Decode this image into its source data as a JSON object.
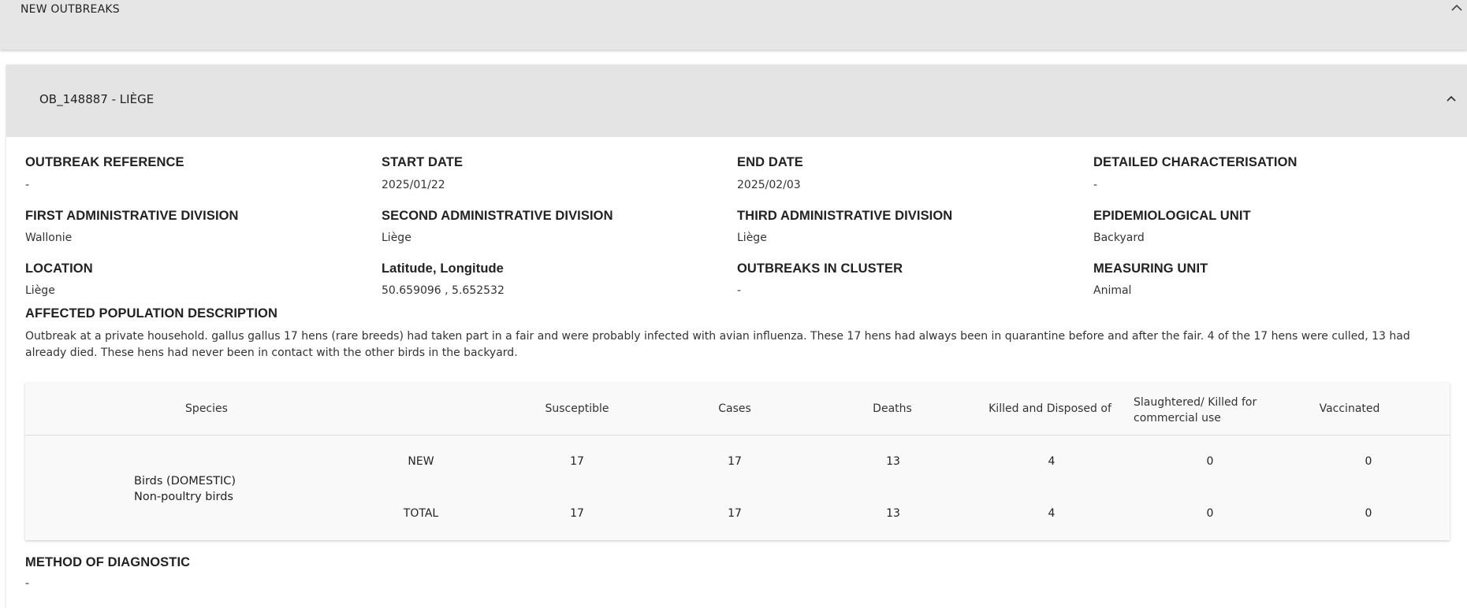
{
  "top_panel": {
    "title": "NEW OUTBREAKS"
  },
  "outbreak": {
    "title": "OB_148887 - LIÈGE",
    "fields": [
      {
        "label": "OUTBREAK REFERENCE",
        "value": "-"
      },
      {
        "label": "START DATE",
        "value": "2025/01/22"
      },
      {
        "label": "END DATE",
        "value": "2025/02/03"
      },
      {
        "label": "DETAILED CHARACTERISATION",
        "value": "-"
      },
      {
        "label": "FIRST ADMINISTRATIVE DIVISION",
        "value": "Wallonie"
      },
      {
        "label": "SECOND ADMINISTRATIVE DIVISION",
        "value": "Liège"
      },
      {
        "label": "THIRD ADMINISTRATIVE DIVISION",
        "value": "Liège"
      },
      {
        "label": "EPIDEMIOLOGICAL UNIT",
        "value": "Backyard"
      },
      {
        "label": "LOCATION",
        "value": "Liège"
      },
      {
        "label": "Latitude, Longitude",
        "value": "50.659096 , 5.652532"
      },
      {
        "label": "OUTBREAKS IN CLUSTER",
        "value": "-"
      },
      {
        "label": "MEASURING UNIT",
        "value": "Animal"
      }
    ],
    "affected_population": {
      "label": "AFFECTED POPULATION DESCRIPTION",
      "text": "Outbreak at a private household. gallus gallus 17 hens (rare breeds) had taken part in a fair and were probably infected with avian influenza. These 17 hens had always been in quarantine before and after the fair. 4 of the 17 hens were culled, 13 had already died. These hens had never been in contact with the other birds in the backyard."
    },
    "table": {
      "headers": {
        "species": "Species",
        "susceptible": "Susceptible",
        "cases": "Cases",
        "deaths": "Deaths",
        "killed": "Killed and Disposed of",
        "slaughtered": "Slaughtered/ Killed for commercial use",
        "vaccinated": "Vaccinated"
      },
      "species_line1": "Birds (DOMESTIC)",
      "species_line2": "Non-poultry birds",
      "rows": [
        {
          "tag": "NEW",
          "values": [
            "17",
            "17",
            "13",
            "4",
            "0",
            "0"
          ]
        },
        {
          "tag": "TOTAL",
          "values": [
            "17",
            "17",
            "13",
            "4",
            "0",
            "0"
          ]
        }
      ]
    },
    "diagnostic": {
      "label": "METHOD OF DIAGNOSTIC",
      "value": "-"
    }
  },
  "icons": {
    "collapse": "chevron-up-icon"
  }
}
